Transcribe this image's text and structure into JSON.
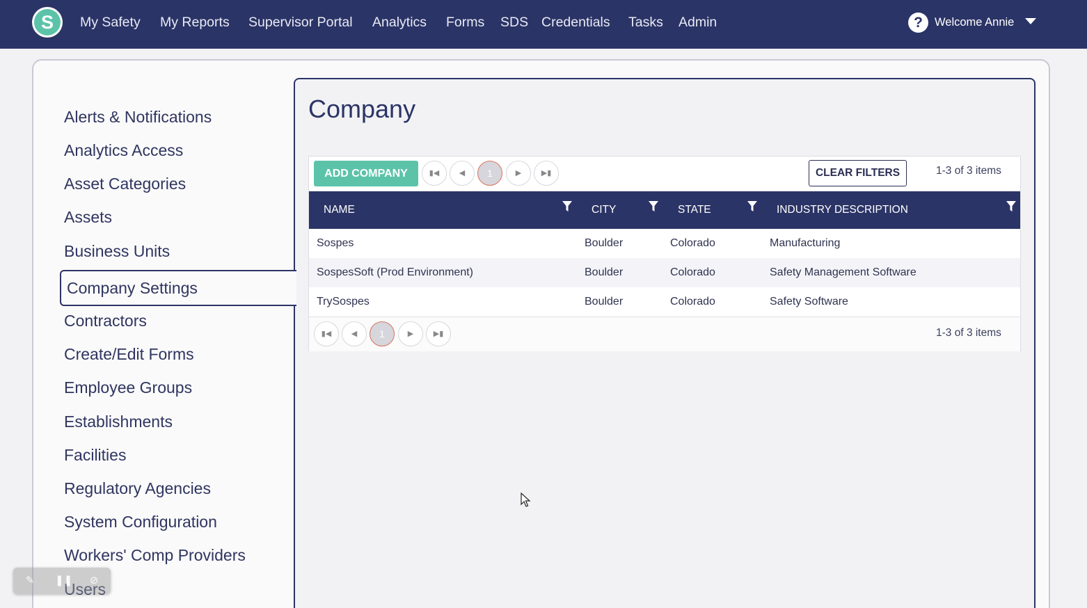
{
  "brand": {
    "logo_letter": "S"
  },
  "topnav": {
    "items": [
      {
        "label": "My Safety"
      },
      {
        "label": "My Reports"
      },
      {
        "label": "Supervisor Portal"
      },
      {
        "label": "Analytics"
      },
      {
        "label": "Forms"
      },
      {
        "label": "SDS"
      },
      {
        "label": "Credentials"
      },
      {
        "label": "Tasks"
      },
      {
        "label": "Admin"
      }
    ],
    "help_glyph": "?",
    "user_menu_label": "Welcome Annie"
  },
  "sidebar": {
    "items": [
      {
        "label": "Alerts & Notifications"
      },
      {
        "label": "Analytics Access"
      },
      {
        "label": "Asset Categories"
      },
      {
        "label": "Assets"
      },
      {
        "label": "Business Units"
      },
      {
        "label": "Company Settings",
        "active": true
      },
      {
        "label": "Contractors"
      },
      {
        "label": "Create/Edit Forms"
      },
      {
        "label": "Employee Groups"
      },
      {
        "label": "Establishments"
      },
      {
        "label": "Facilities"
      },
      {
        "label": "Regulatory Agencies"
      },
      {
        "label": "System Configuration"
      },
      {
        "label": "Workers' Comp Providers"
      },
      {
        "label": "Users"
      }
    ]
  },
  "main": {
    "title": "Company",
    "grid": {
      "add_label": "ADD COMPANY",
      "clear_filters_label": "CLEAR FILTERS",
      "current_page": "1",
      "item_count": "1-3 of 3 items",
      "columns": [
        "NAME",
        "CITY",
        "STATE",
        "INDUSTRY DESCRIPTION"
      ],
      "rows": [
        [
          "Sospes",
          "Boulder",
          "Colorado",
          "Manufacturing"
        ],
        [
          "SospesSoft (Prod Environment)",
          "Boulder",
          "Colorado",
          "Safety Management Software"
        ],
        [
          "TrySospes",
          "Boulder",
          "Colorado",
          "Safety Software"
        ]
      ]
    }
  },
  "colors": {
    "nav_bg": "#2b3466",
    "accent": "#5cc3a9",
    "pager_active_border": "#d9735a"
  },
  "icons": {
    "logo": "s-logo-icon",
    "help": "question-circle-icon",
    "user_caret": "caret-down-icon",
    "pager_first": "page-first-icon",
    "pager_prev": "page-prev-icon",
    "pager_next": "page-next-icon",
    "pager_last": "page-last-icon",
    "column_filter": "filter-icon",
    "overlay_edit": "edit-icon",
    "overlay_pause": "pause-icon",
    "overlay_hide": "hide-icon"
  }
}
